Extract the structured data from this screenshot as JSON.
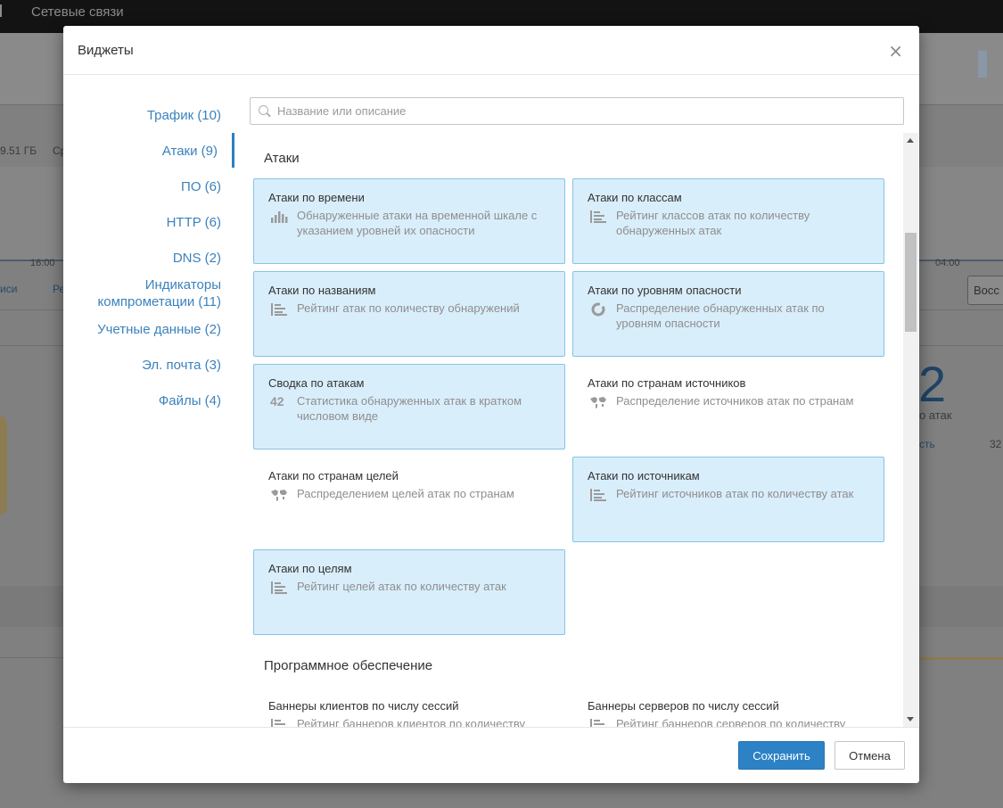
{
  "background": {
    "top_tab": "Сетевые связи",
    "size_text": "9.51 ГБ",
    "size_suffix": "Ср",
    "time_left": "16:00",
    "time_right": "04:00",
    "link_left": "иси",
    "link_left2": "Ре",
    "button_right": "Восс",
    "big_number": "2",
    "attacks_label": "о атак",
    "right_link": "сть",
    "right_value": "32"
  },
  "modal": {
    "title": "Виджеты",
    "close_glyph": "×",
    "search": {
      "placeholder": "Название или описание",
      "value": ""
    },
    "nav": [
      {
        "label": "Трафик (10)"
      },
      {
        "label": "Атаки (9)",
        "active": true
      },
      {
        "label": "ПО (6)"
      },
      {
        "label": "HTTP (6)"
      },
      {
        "label": "DNS (2)"
      },
      {
        "label": "Индикаторы компрометации (11)"
      },
      {
        "label": "Учетные данные (2)"
      },
      {
        "label": "Эл. почта (3)"
      },
      {
        "label": "Файлы (4)"
      }
    ],
    "sections": [
      {
        "title": "Атаки",
        "widgets": [
          {
            "title": "Атаки по времени",
            "description": "Обнаруженные атаки на временной шкале с указанием уровней их опасности",
            "icon": "bar-chart-icon",
            "selected": true
          },
          {
            "title": "Атаки по классам",
            "description": "Рейтинг классов атак по количеству обнаруженных атак",
            "icon": "rating-list-icon",
            "selected": true
          },
          {
            "title": "Атаки по названиям",
            "description": "Рейтинг атак по количеству обнаружений",
            "icon": "rating-list-icon",
            "selected": true
          },
          {
            "title": "Атаки по уровням опасности",
            "description": "Распределение обнаруженных атак по уровням опасности",
            "icon": "donut-chart-icon",
            "selected": true
          },
          {
            "title": "Сводка по атакам",
            "description": "Статистика обнаруженных атак в кратком числовом виде",
            "icon": "number-icon",
            "icon_text": "42",
            "selected": true
          },
          {
            "title": "Атаки по странам источников",
            "description": "Распределение источников атак по странам",
            "icon": "world-map-icon",
            "selected": false
          },
          {
            "title": "Атаки по странам целей",
            "description": "Распределением целей атак по странам",
            "icon": "world-map-icon",
            "selected": false
          },
          {
            "title": "Атаки по источникам",
            "description": "Рейтинг источников атак по количеству атак",
            "icon": "rating-list-icon",
            "selected": true
          },
          {
            "title": "Атаки по целям",
            "description": "Рейтинг целей атак по количеству атак",
            "icon": "rating-list-icon",
            "selected": true
          }
        ]
      },
      {
        "title": "Программное обеспечение",
        "widgets": [
          {
            "title": "Баннеры клиентов по числу сессий",
            "description": "Рейтинг баннеров клиентов по количеству",
            "icon": "rating-list-icon",
            "selected": false
          },
          {
            "title": "Баннеры серверов по числу сессий",
            "description": "Рейтинг баннеров серверов по количеству",
            "icon": "rating-list-icon",
            "selected": false
          }
        ]
      }
    ],
    "footer": {
      "save_label": "Сохранить",
      "cancel_label": "Отмена"
    }
  }
}
